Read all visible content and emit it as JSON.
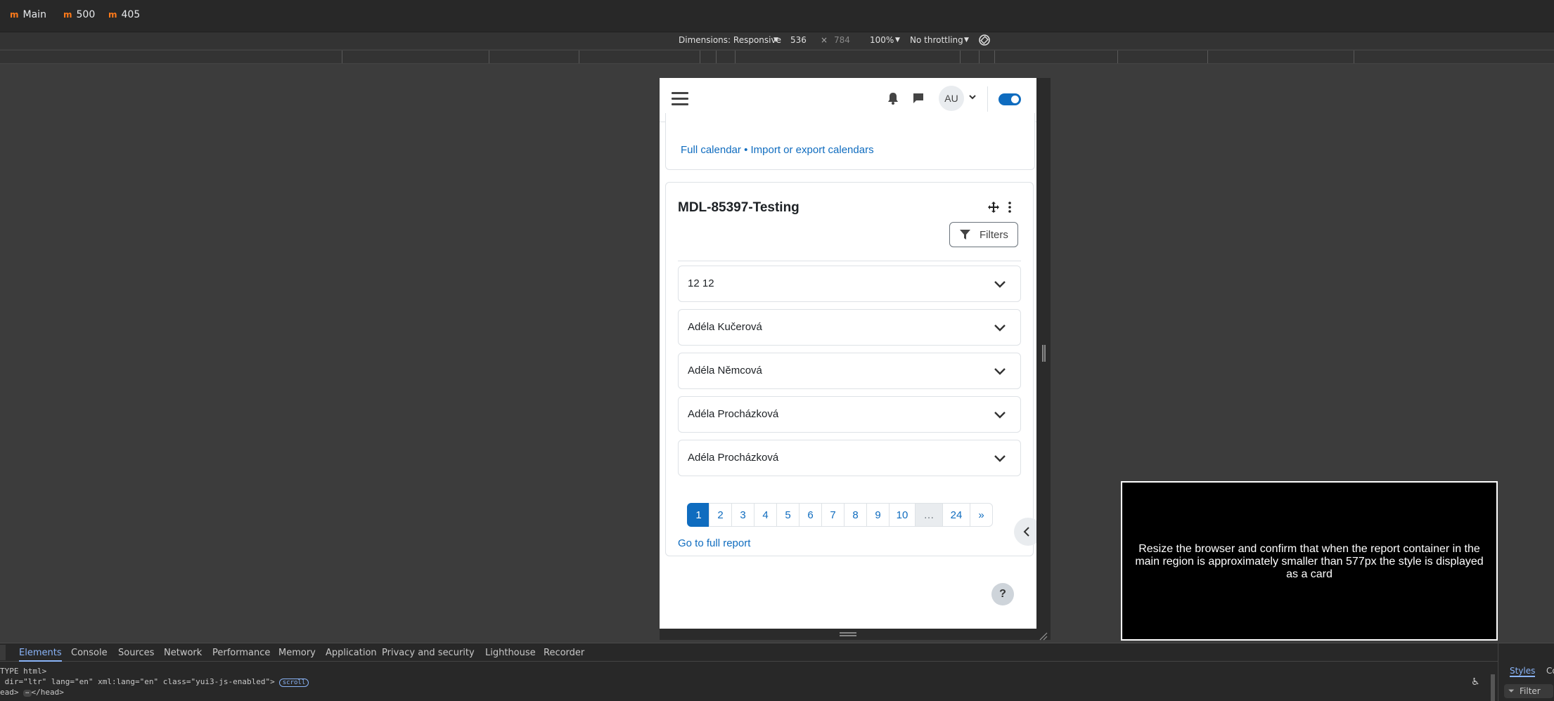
{
  "browser": {
    "bookmarks": [
      {
        "icon": "moodle-icon",
        "label": "Main"
      },
      {
        "icon": "moodle-icon",
        "label": "500"
      },
      {
        "icon": "moodle-icon",
        "label": "405"
      }
    ]
  },
  "device_toolbar": {
    "dimensions_label": "Dimensions: Responsive",
    "width": "536",
    "times": "×",
    "height": "784",
    "zoom": "100%",
    "throttling": "No throttling"
  },
  "page": {
    "header": {
      "avatar_initials": "AU"
    },
    "calendar_links": {
      "full_calendar": "Full calendar",
      "separator": "•",
      "import_export": "Import or export calendars"
    },
    "block": {
      "title": "MDL-85397-Testing",
      "filters_label": "Filters",
      "rows": [
        {
          "label": "12 12"
        },
        {
          "label": "Adéla Kučerová"
        },
        {
          "label": "Adéla Němcová"
        },
        {
          "label": "Adéla Procházková"
        },
        {
          "label": "Adéla Procházková"
        }
      ],
      "pagination": [
        "1",
        "2",
        "3",
        "4",
        "5",
        "6",
        "7",
        "8",
        "9",
        "10",
        "…",
        "24",
        "»"
      ],
      "active_page": "1",
      "full_report_link": "Go to full report"
    },
    "help_label": "?"
  },
  "overlay": {
    "text": "Resize the browser and confirm that when the report container in the main region is approximately smaller than 577px the style is displayed as a card"
  },
  "devtools": {
    "tabs": [
      "Elements",
      "Console",
      "Sources",
      "Network",
      "Performance",
      "Memory",
      "Application",
      "Privacy and security",
      "Lighthouse",
      "Recorder"
    ],
    "active_tab": "Elements",
    "code_line1": "TYPE html>",
    "code_line2": " dir=\"ltr\" lang=\"en\" xml:lang=\"en\" class=\"yui3-js-enabled\">",
    "scroll_badge": "scroll",
    "code_line3": "ead> ",
    "code_line3b": "</head>",
    "styles_tab": "Styles",
    "styles_tab2": "Co",
    "filter_placeholder": "Filter"
  },
  "colors": {
    "primary": "#0f6cbf",
    "devtools_bg": "#282828",
    "page_bg": "#3c3c3c"
  }
}
